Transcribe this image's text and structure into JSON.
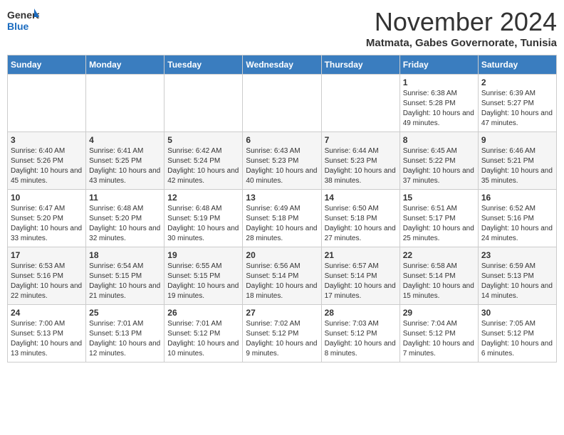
{
  "header": {
    "logo_general": "General",
    "logo_blue": "Blue",
    "month_title": "November 2024",
    "location": "Matmata, Gabes Governorate, Tunisia"
  },
  "weekdays": [
    "Sunday",
    "Monday",
    "Tuesday",
    "Wednesday",
    "Thursday",
    "Friday",
    "Saturday"
  ],
  "weeks": [
    [
      {
        "day": "",
        "info": ""
      },
      {
        "day": "",
        "info": ""
      },
      {
        "day": "",
        "info": ""
      },
      {
        "day": "",
        "info": ""
      },
      {
        "day": "",
        "info": ""
      },
      {
        "day": "1",
        "info": "Sunrise: 6:38 AM\nSunset: 5:28 PM\nDaylight: 10 hours and 49 minutes."
      },
      {
        "day": "2",
        "info": "Sunrise: 6:39 AM\nSunset: 5:27 PM\nDaylight: 10 hours and 47 minutes."
      }
    ],
    [
      {
        "day": "3",
        "info": "Sunrise: 6:40 AM\nSunset: 5:26 PM\nDaylight: 10 hours and 45 minutes."
      },
      {
        "day": "4",
        "info": "Sunrise: 6:41 AM\nSunset: 5:25 PM\nDaylight: 10 hours and 43 minutes."
      },
      {
        "day": "5",
        "info": "Sunrise: 6:42 AM\nSunset: 5:24 PM\nDaylight: 10 hours and 42 minutes."
      },
      {
        "day": "6",
        "info": "Sunrise: 6:43 AM\nSunset: 5:23 PM\nDaylight: 10 hours and 40 minutes."
      },
      {
        "day": "7",
        "info": "Sunrise: 6:44 AM\nSunset: 5:23 PM\nDaylight: 10 hours and 38 minutes."
      },
      {
        "day": "8",
        "info": "Sunrise: 6:45 AM\nSunset: 5:22 PM\nDaylight: 10 hours and 37 minutes."
      },
      {
        "day": "9",
        "info": "Sunrise: 6:46 AM\nSunset: 5:21 PM\nDaylight: 10 hours and 35 minutes."
      }
    ],
    [
      {
        "day": "10",
        "info": "Sunrise: 6:47 AM\nSunset: 5:20 PM\nDaylight: 10 hours and 33 minutes."
      },
      {
        "day": "11",
        "info": "Sunrise: 6:48 AM\nSunset: 5:20 PM\nDaylight: 10 hours and 32 minutes."
      },
      {
        "day": "12",
        "info": "Sunrise: 6:48 AM\nSunset: 5:19 PM\nDaylight: 10 hours and 30 minutes."
      },
      {
        "day": "13",
        "info": "Sunrise: 6:49 AM\nSunset: 5:18 PM\nDaylight: 10 hours and 28 minutes."
      },
      {
        "day": "14",
        "info": "Sunrise: 6:50 AM\nSunset: 5:18 PM\nDaylight: 10 hours and 27 minutes."
      },
      {
        "day": "15",
        "info": "Sunrise: 6:51 AM\nSunset: 5:17 PM\nDaylight: 10 hours and 25 minutes."
      },
      {
        "day": "16",
        "info": "Sunrise: 6:52 AM\nSunset: 5:16 PM\nDaylight: 10 hours and 24 minutes."
      }
    ],
    [
      {
        "day": "17",
        "info": "Sunrise: 6:53 AM\nSunset: 5:16 PM\nDaylight: 10 hours and 22 minutes."
      },
      {
        "day": "18",
        "info": "Sunrise: 6:54 AM\nSunset: 5:15 PM\nDaylight: 10 hours and 21 minutes."
      },
      {
        "day": "19",
        "info": "Sunrise: 6:55 AM\nSunset: 5:15 PM\nDaylight: 10 hours and 19 minutes."
      },
      {
        "day": "20",
        "info": "Sunrise: 6:56 AM\nSunset: 5:14 PM\nDaylight: 10 hours and 18 minutes."
      },
      {
        "day": "21",
        "info": "Sunrise: 6:57 AM\nSunset: 5:14 PM\nDaylight: 10 hours and 17 minutes."
      },
      {
        "day": "22",
        "info": "Sunrise: 6:58 AM\nSunset: 5:14 PM\nDaylight: 10 hours and 15 minutes."
      },
      {
        "day": "23",
        "info": "Sunrise: 6:59 AM\nSunset: 5:13 PM\nDaylight: 10 hours and 14 minutes."
      }
    ],
    [
      {
        "day": "24",
        "info": "Sunrise: 7:00 AM\nSunset: 5:13 PM\nDaylight: 10 hours and 13 minutes."
      },
      {
        "day": "25",
        "info": "Sunrise: 7:01 AM\nSunset: 5:13 PM\nDaylight: 10 hours and 12 minutes."
      },
      {
        "day": "26",
        "info": "Sunrise: 7:01 AM\nSunset: 5:12 PM\nDaylight: 10 hours and 10 minutes."
      },
      {
        "day": "27",
        "info": "Sunrise: 7:02 AM\nSunset: 5:12 PM\nDaylight: 10 hours and 9 minutes."
      },
      {
        "day": "28",
        "info": "Sunrise: 7:03 AM\nSunset: 5:12 PM\nDaylight: 10 hours and 8 minutes."
      },
      {
        "day": "29",
        "info": "Sunrise: 7:04 AM\nSunset: 5:12 PM\nDaylight: 10 hours and 7 minutes."
      },
      {
        "day": "30",
        "info": "Sunrise: 7:05 AM\nSunset: 5:12 PM\nDaylight: 10 hours and 6 minutes."
      }
    ]
  ]
}
